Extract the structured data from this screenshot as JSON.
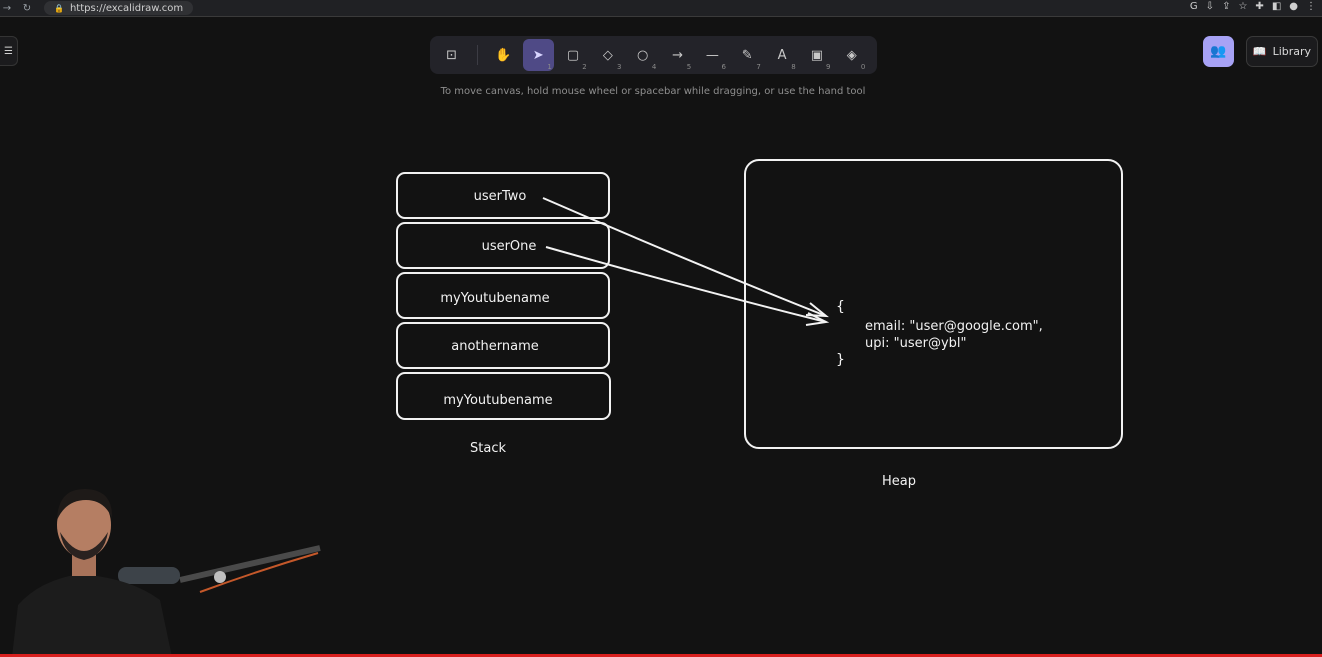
{
  "browser": {
    "url": "https://excalidraw.com"
  },
  "toolbar": {
    "tools": [
      {
        "name": "lock",
        "glyph": "⊡",
        "key": ""
      },
      {
        "name": "hand",
        "glyph": "✋",
        "key": ""
      },
      {
        "name": "selection",
        "glyph": "➤",
        "key": "1",
        "active": true
      },
      {
        "name": "rectangle",
        "glyph": "▢",
        "key": "2"
      },
      {
        "name": "diamond",
        "glyph": "◇",
        "key": "3"
      },
      {
        "name": "ellipse",
        "glyph": "○",
        "key": "4"
      },
      {
        "name": "arrow",
        "glyph": "→",
        "key": "5"
      },
      {
        "name": "line",
        "glyph": "—",
        "key": "6"
      },
      {
        "name": "draw",
        "glyph": "✎",
        "key": "7"
      },
      {
        "name": "text",
        "glyph": "A",
        "key": "8"
      },
      {
        "name": "image",
        "glyph": "▣",
        "key": "9"
      },
      {
        "name": "eraser",
        "glyph": "◈",
        "key": "0"
      }
    ]
  },
  "hint": "To move canvas, hold mouse wheel or spacebar while dragging, or use the hand tool",
  "library_label": "Library",
  "diagram": {
    "stack_items": [
      "userTwo",
      "userOne",
      "myYoutubename",
      "anothername",
      "myYoutubename"
    ],
    "stack_label": "Stack",
    "heap_label": "Heap",
    "heap_open_brace": "{",
    "heap_line1": "email: \"user@google.com\",",
    "heap_line2": "upi: \"user@ybl\"",
    "heap_close_brace": "}"
  },
  "colors": {
    "background": "#121212",
    "accent": "#a7a2f5",
    "active_tool": "#4f4a86",
    "stroke": "#f2f2f2"
  }
}
